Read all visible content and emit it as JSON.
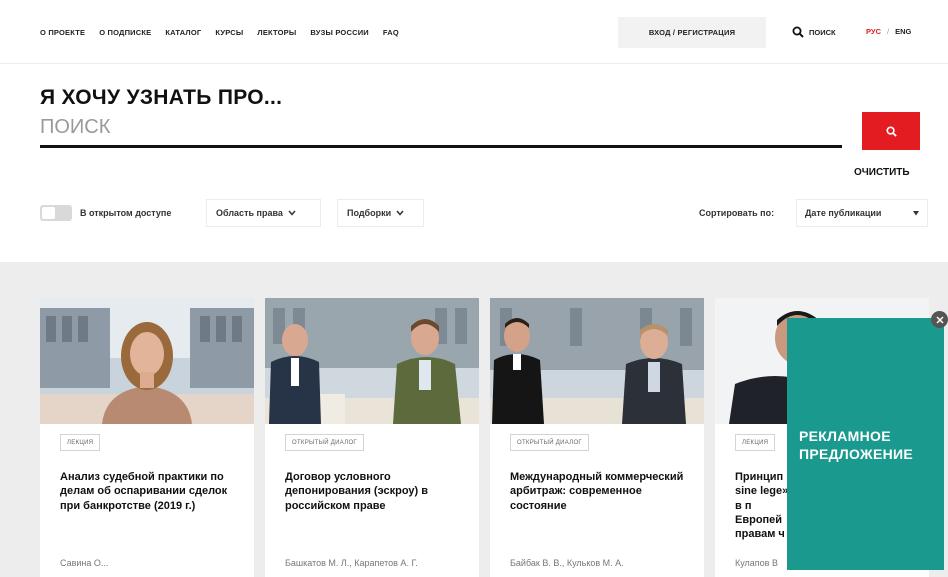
{
  "nav": {
    "links": [
      "О ПРОЕКТЕ",
      "О ПОДПИСКЕ",
      "КАТАЛОГ",
      "КУРСЫ",
      "ЛЕКТОРЫ",
      "ВУЗЫ РОССИИ",
      "FAQ"
    ],
    "login": "ВХОД / РЕГИСТРАЦИЯ",
    "search": "ПОИСК",
    "lang_ru": "РУС",
    "lang_sep": "/",
    "lang_en": "ENG"
  },
  "search": {
    "headline": "Я ХОЧУ УЗНАТЬ ПРО...",
    "placeholder": "ПОИСК",
    "clear": "ОЧИСТИТЬ"
  },
  "filters": {
    "open_access": "В открытом доступе",
    "area": "Область права",
    "selections": "Подборки",
    "sort_label": "Сортировать по:",
    "sort_value": "Дате публикации"
  },
  "cards": [
    {
      "tag": "ЛЕКЦИЯ",
      "title": "Анализ судебной практики по делам об оспаривании сделок при банкротстве (2019 г.)",
      "authors": "Савина О..."
    },
    {
      "tag": "ОТКРЫТЫЙ ДИАЛОГ",
      "title": "Договор условного депонирования (эскроу) в российском праве",
      "authors": "Башкатов М. Л., Карапетов А. Г."
    },
    {
      "tag": "ОТКРЫТЫЙ ДИАЛОГ",
      "title": "Международный коммерческий арбитраж: современное состояние",
      "authors": "Байбак В. В., Кульков М. А."
    },
    {
      "tag": "ЛЕКЦИЯ",
      "title": "Принцип sine lege» в п Европей правам ч",
      "authors": "Кулапов В"
    }
  ],
  "ad": {
    "text": "РЕКЛАМНОЕ ПРЕДЛОЖЕНИЕ"
  },
  "colors": {
    "accent": "#e21c20",
    "ad": "#1a9a8e"
  }
}
